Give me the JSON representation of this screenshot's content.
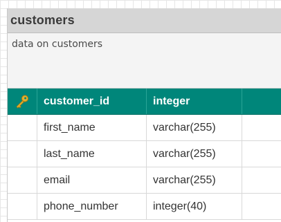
{
  "entity": {
    "title": "customers",
    "description": "data on customers",
    "columns": [
      {
        "name": "customer_id",
        "type": "integer",
        "primary_key": true,
        "icon": "key-icon"
      },
      {
        "name": "first_name",
        "type": "varchar(255)",
        "primary_key": false
      },
      {
        "name": "last_name",
        "type": "varchar(255)",
        "primary_key": false
      },
      {
        "name": "email",
        "type": "varchar(255)",
        "primary_key": false
      },
      {
        "name": "phone_number",
        "type": "integer(40)",
        "primary_key": false
      }
    ]
  },
  "colors": {
    "primary_key_row": "#00867a",
    "header": "#d6d6d6",
    "key_icon": "#e2b02f"
  }
}
